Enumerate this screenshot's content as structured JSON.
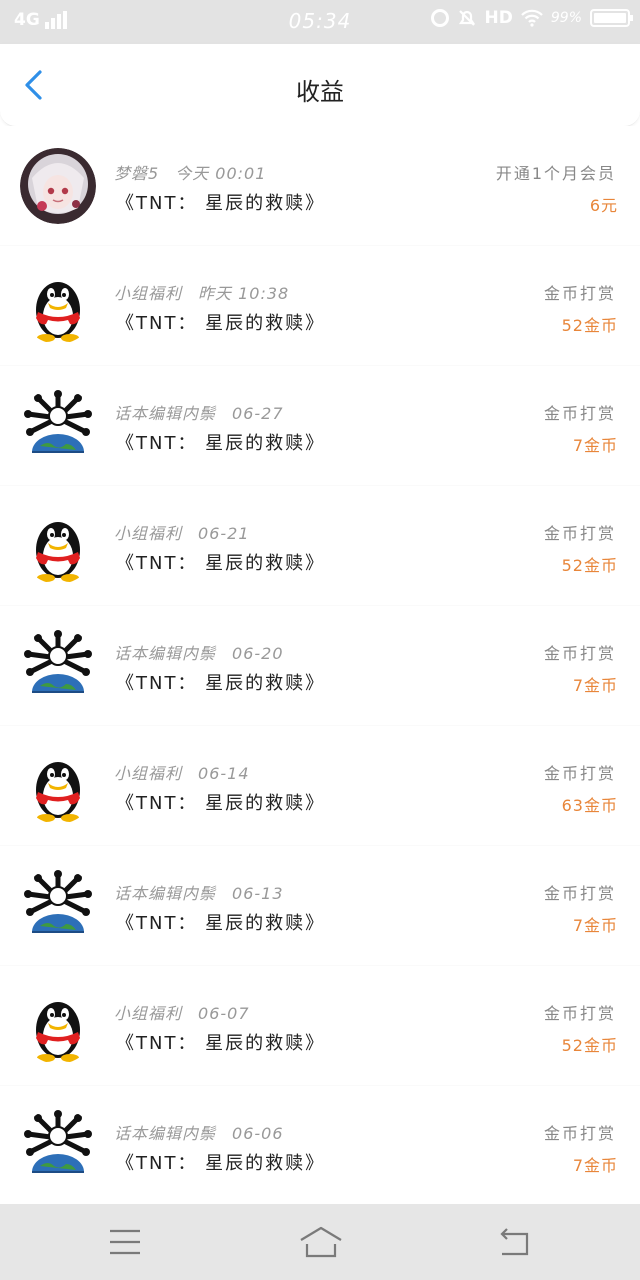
{
  "status_bar": {
    "network": "4G",
    "time": "05:34",
    "hd": "HD",
    "battery": "99%"
  },
  "header": {
    "title": "收益"
  },
  "records": [
    {
      "user": "梦磐5",
      "date": "今天 00:01",
      "book": "《TNT：  星辰的救赎》",
      "type": "开通1个月会员",
      "amount": "6元",
      "avatar": "anime"
    },
    {
      "user": "小组福利",
      "date": "昨天 10:38",
      "book": "《TNT：  星辰的救赎》",
      "type": "金币打赏",
      "amount": "52金币",
      "avatar": "penguin"
    },
    {
      "user": "话本编辑内鬃",
      "date": "06-27",
      "book": "《TNT：  星辰的救赎》",
      "type": "金币打赏",
      "amount": "7金币",
      "avatar": "globe"
    },
    {
      "user": "小组福利",
      "date": "06-21",
      "book": "《TNT：  星辰的救赎》",
      "type": "金币打赏",
      "amount": "52金币",
      "avatar": "penguin"
    },
    {
      "user": "话本编辑内鬃",
      "date": "06-20",
      "book": "《TNT：  星辰的救赎》",
      "type": "金币打赏",
      "amount": "7金币",
      "avatar": "globe"
    },
    {
      "user": "小组福利",
      "date": "06-14",
      "book": "《TNT：  星辰的救赎》",
      "type": "金币打赏",
      "amount": "63金币",
      "avatar": "penguin"
    },
    {
      "user": "话本编辑内鬃",
      "date": "06-13",
      "book": "《TNT：  星辰的救赎》",
      "type": "金币打赏",
      "amount": "7金币",
      "avatar": "globe"
    },
    {
      "user": "小组福利",
      "date": "06-07",
      "book": "《TNT：  星辰的救赎》",
      "type": "金币打赏",
      "amount": "52金币",
      "avatar": "penguin"
    },
    {
      "user": "话本编辑内鬃",
      "date": "06-06",
      "book": "《TNT：  星辰的救赎》",
      "type": "金币打赏",
      "amount": "7金币",
      "avatar": "globe"
    }
  ],
  "colors": {
    "accent": "#2f8fe8",
    "amount": "#e8863a",
    "meta": "#999999"
  },
  "icons": {
    "back": "chevron-left-icon",
    "menu": "menu-icon",
    "home": "home-icon",
    "return": "return-icon"
  }
}
